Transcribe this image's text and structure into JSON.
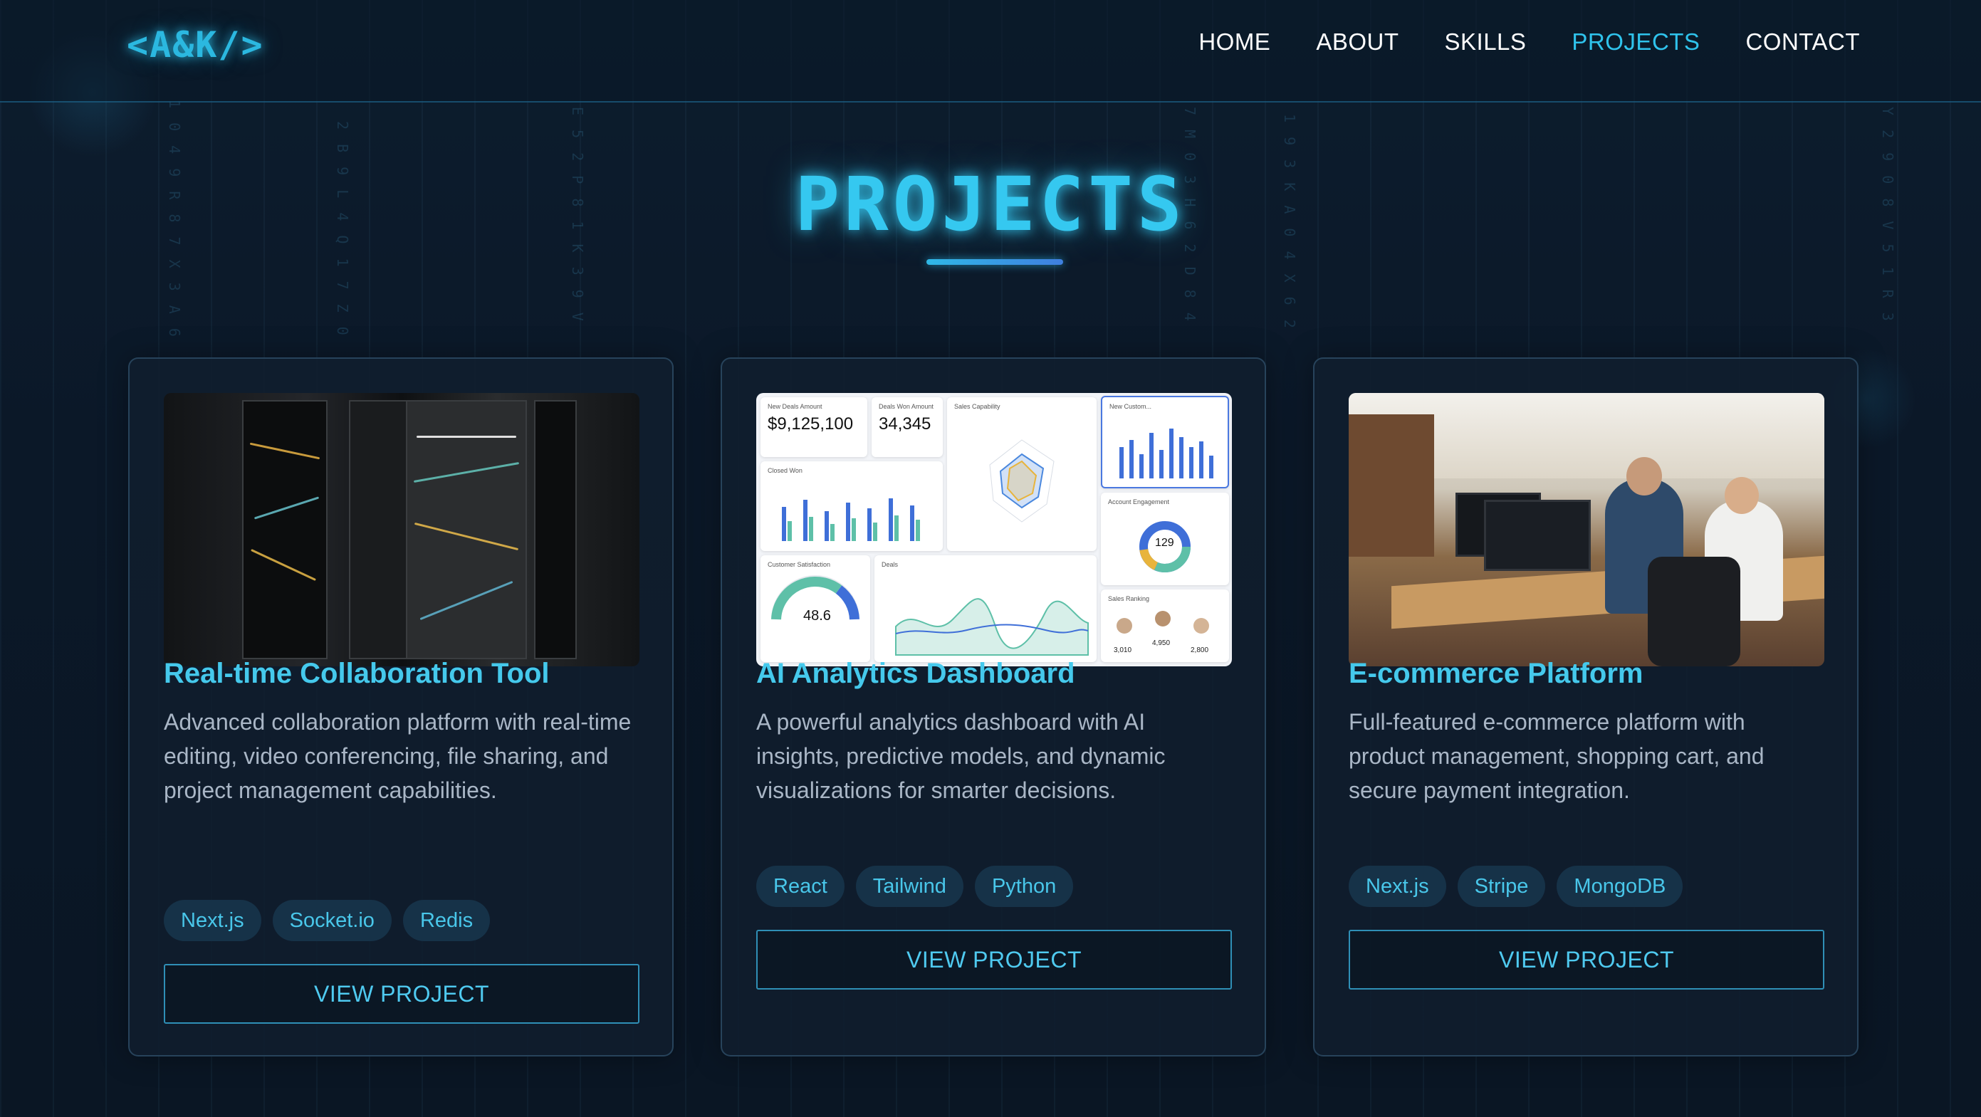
{
  "header": {
    "logo": "<A&K/>",
    "nav": [
      {
        "label": "HOME",
        "active": false
      },
      {
        "label": "ABOUT",
        "active": false
      },
      {
        "label": "SKILLS",
        "active": false
      },
      {
        "label": "PROJECTS",
        "active": true
      },
      {
        "label": "CONTACT",
        "active": false
      }
    ]
  },
  "section": {
    "title": "PROJECTS"
  },
  "projects": [
    {
      "title": "Real-time Collaboration Tool",
      "description": "Advanced collaboration platform with real-time editing, video conferencing, file sharing, and project management capabilities.",
      "tags": [
        "Next.js",
        "Socket.io",
        "Redis"
      ],
      "button": "VIEW PROJECT",
      "image": "server-rack-photo"
    },
    {
      "title": "AI Analytics Dashboard",
      "description": "A powerful analytics dashboard with AI insights, predictive models, and dynamic visualizations for smarter decisions.",
      "tags": [
        "React",
        "Tailwind",
        "Python"
      ],
      "button": "VIEW PROJECT",
      "image": "analytics-dashboard-screenshot",
      "dashboard": {
        "kpi1_label": "New Deals Amount",
        "kpi1_value": "$9,125,100",
        "kpi2_label": "Deals Won Amount",
        "kpi2_value": "34,345",
        "radar_label": "Sales Capability",
        "new_customers_label": "New Custom...",
        "closed_won_label": "Closed Won",
        "engagement_label": "Account Engagement",
        "engagement_value": "129",
        "satisfaction_label": "Customer Satisfaction",
        "satisfaction_value": "48.6",
        "deals_label": "Deals",
        "ranking_label": "Sales Ranking",
        "ranking": [
          "3,010",
          "4,950",
          "2,800"
        ]
      }
    },
    {
      "title": "E-commerce Platform",
      "description": "Full-featured e-commerce platform with product management, shopping cart, and secure payment integration.",
      "tags": [
        "Next.js",
        "Stripe",
        "MongoDB"
      ],
      "button": "VIEW PROJECT",
      "image": "office-team-photo"
    }
  ],
  "colors": {
    "background": "#0b1726",
    "accent": "#2fc3ec",
    "card": "#101e2e",
    "tag_bg": "#163248"
  }
}
